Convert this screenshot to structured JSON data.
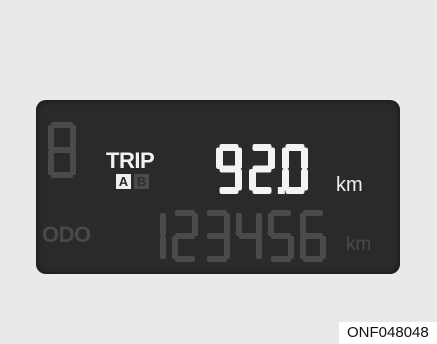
{
  "display": {
    "trip_label": "TRIP",
    "trip_mode_active": "A",
    "trip_mode_inactive": "B",
    "trip_value": "92.0",
    "trip_unit": "km",
    "odo_label": "ODO",
    "odo_value": "123456",
    "odo_unit": "km"
  },
  "caption": "ONF048048",
  "colors": {
    "background": "#e9e9e9",
    "lcd_background": "#2a2a2a",
    "lit_segment": "#f3f3f3",
    "dim_segment": "#4a4a4a"
  }
}
